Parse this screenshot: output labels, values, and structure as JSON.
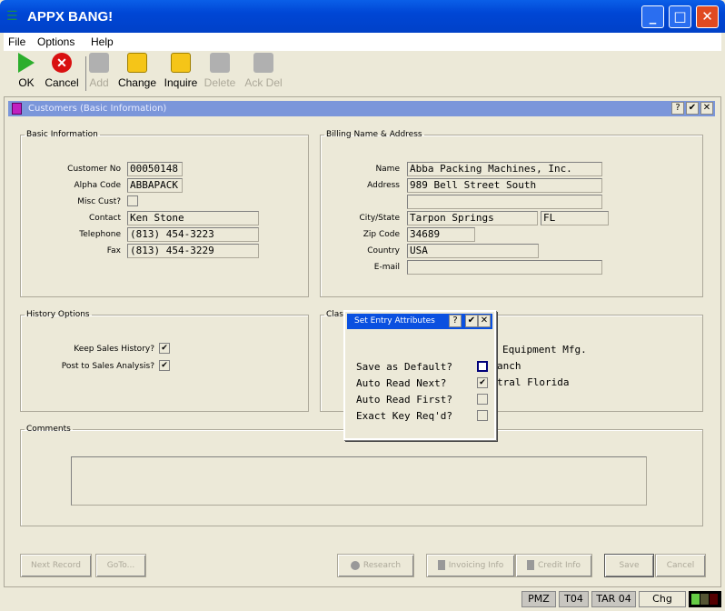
{
  "window": {
    "title": "APPX BANG!",
    "controls": [
      "_",
      "□",
      "✕"
    ]
  },
  "menu": [
    "File",
    "Options",
    "Help"
  ],
  "toolbar": [
    {
      "label": "OK",
      "enabled": true
    },
    {
      "label": "Cancel",
      "enabled": true
    },
    {
      "label": "Add",
      "enabled": false
    },
    {
      "label": "Change",
      "enabled": true
    },
    {
      "label": "Inquire",
      "enabled": true
    },
    {
      "label": "Delete",
      "enabled": false
    },
    {
      "label": "Ack Del",
      "enabled": false
    }
  ],
  "frame": {
    "title": "Customers (Basic Information)",
    "buttons": [
      "?",
      "✔",
      "✕"
    ]
  },
  "basic": {
    "legend": "Basic Information",
    "labels": [
      "Customer No",
      "Alpha Code",
      "Misc Cust?",
      "Contact",
      "Telephone",
      "Fax"
    ],
    "customer_no": "00050148",
    "alpha_code": "ABBAPACK",
    "misc_cust": false,
    "contact": "Ken Stone",
    "telephone": "(813) 454-3223",
    "fax": "(813) 454-3229"
  },
  "billing": {
    "legend": "Billing Name & Address",
    "labels": [
      "Name",
      "Address",
      "City/State",
      "Zip Code",
      "Country",
      "E-mail"
    ],
    "name": "Abba Packing Machines, Inc.",
    "address1": "989 Bell Street South",
    "address2": "",
    "city": "Tarpon Springs",
    "state": "FL",
    "zip": "34689",
    "country": "USA",
    "email": ""
  },
  "history": {
    "legend": "History Options",
    "keep_label": "Keep Sales History?",
    "keep": true,
    "post_label": "Post to Sales Analysis?",
    "post": true
  },
  "class": {
    "legend": "Clas",
    "visible_values": [
      "Equipment Mfg.",
      "anch",
      "tral Florida"
    ]
  },
  "comments": {
    "legend": "Comments",
    "value": ""
  },
  "buttons": {
    "next": "Next Record",
    "goto": "GoTo...",
    "research": "Research",
    "invoicing": "Invoicing Info",
    "credit": "Credit Info",
    "save": "Save",
    "cancel": "Cancel"
  },
  "dialog": {
    "title": "Set Entry Attributes",
    "buttons": [
      "?",
      "✔",
      "✕"
    ],
    "options": [
      {
        "label": "Save as Default?",
        "checked": false
      },
      {
        "label": "Auto Read Next?",
        "checked": true
      },
      {
        "label": "Auto Read First?",
        "checked": false
      },
      {
        "label": "Exact Key Req'd?",
        "checked": false
      }
    ]
  },
  "status": {
    "user": "PMZ",
    "terminal": "T04",
    "app": "TAR 04",
    "mode": "Chg"
  },
  "colors": {
    "titlebar": "#0046d5",
    "frame_title": "#7b96da",
    "dialog_title": "#0a50e0",
    "ok": "#2cae2c",
    "cancel": "#d91010",
    "folder": "#f5c518"
  }
}
